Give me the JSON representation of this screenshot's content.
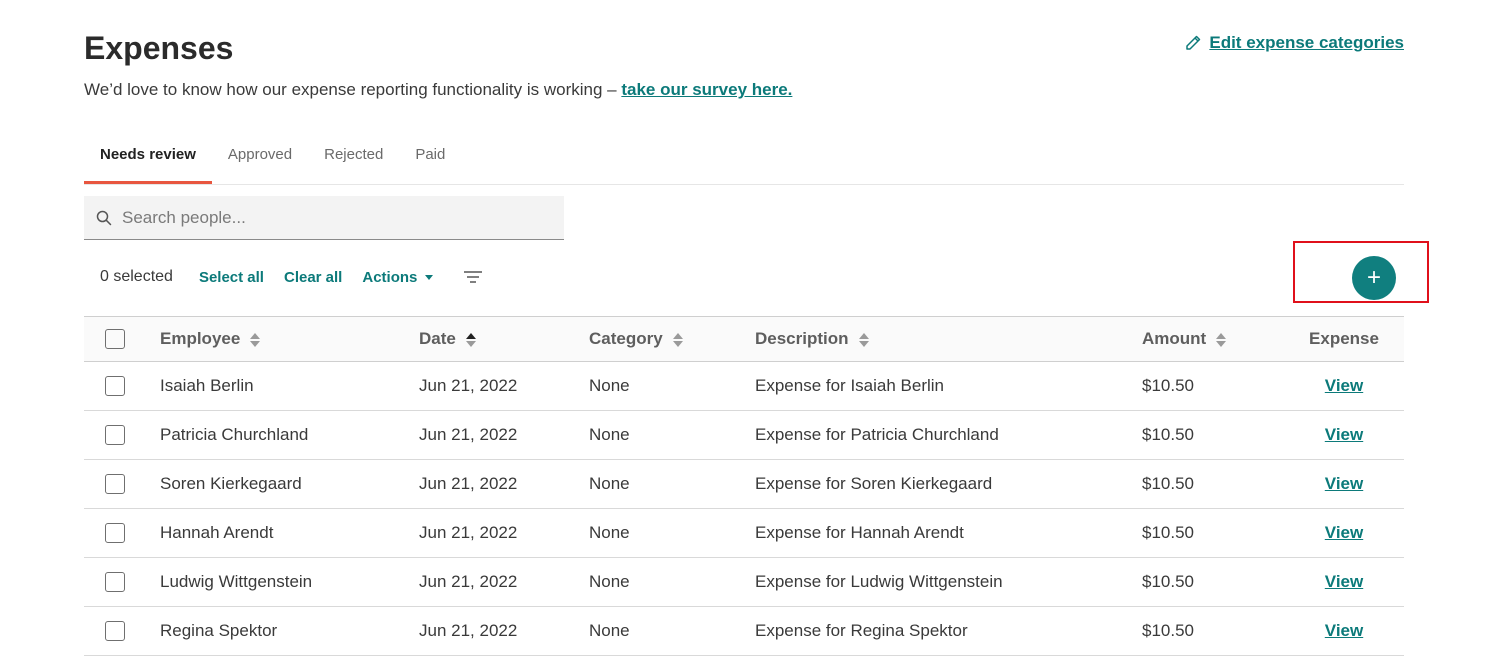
{
  "header": {
    "title": "Expenses",
    "edit_categories": "Edit expense categories",
    "survey_text": "We’d love to know how our expense reporting functionality is working – ",
    "survey_link": "take our survey here."
  },
  "tabs": [
    {
      "label": "Needs review",
      "active": true
    },
    {
      "label": "Approved",
      "active": false
    },
    {
      "label": "Rejected",
      "active": false
    },
    {
      "label": "Paid",
      "active": false
    }
  ],
  "search": {
    "placeholder": "Search people..."
  },
  "toolbar": {
    "selected_count": "0 selected",
    "select_all": "Select all",
    "clear_all": "Clear all",
    "actions": "Actions"
  },
  "add_button": {
    "label": "+"
  },
  "table": {
    "columns": {
      "employee": "Employee",
      "date": "Date",
      "category": "Category",
      "description": "Description",
      "amount": "Amount",
      "expense": "Expense"
    },
    "rows": [
      {
        "employee": "Isaiah Berlin",
        "date": "Jun 21, 2022",
        "category": "None",
        "description": "Expense for Isaiah Berlin",
        "amount": "$10.50",
        "link": "View"
      },
      {
        "employee": "Patricia Churchland",
        "date": "Jun 21, 2022",
        "category": "None",
        "description": "Expense for Patricia Churchland",
        "amount": "$10.50",
        "link": "View"
      },
      {
        "employee": "Soren Kierkegaard",
        "date": "Jun 21, 2022",
        "category": "None",
        "description": "Expense for Soren Kierkegaard",
        "amount": "$10.50",
        "link": "View"
      },
      {
        "employee": "Hannah Arendt",
        "date": "Jun 21, 2022",
        "category": "None",
        "description": "Expense for Hannah Arendt",
        "amount": "$10.50",
        "link": "View"
      },
      {
        "employee": "Ludwig Wittgenstein",
        "date": "Jun 21, 2022",
        "category": "None",
        "description": "Expense for Ludwig Wittgenstein",
        "amount": "$10.50",
        "link": "View"
      },
      {
        "employee": "Regina Spektor",
        "date": "Jun 21, 2022",
        "category": "None",
        "description": "Expense for Regina Spektor",
        "amount": "$10.50",
        "link": "View"
      }
    ]
  },
  "colors": {
    "accent": "#0c7a7a",
    "tab_underline": "#e8563f",
    "add_button": "#107f7f",
    "highlight": "#e0101b"
  }
}
